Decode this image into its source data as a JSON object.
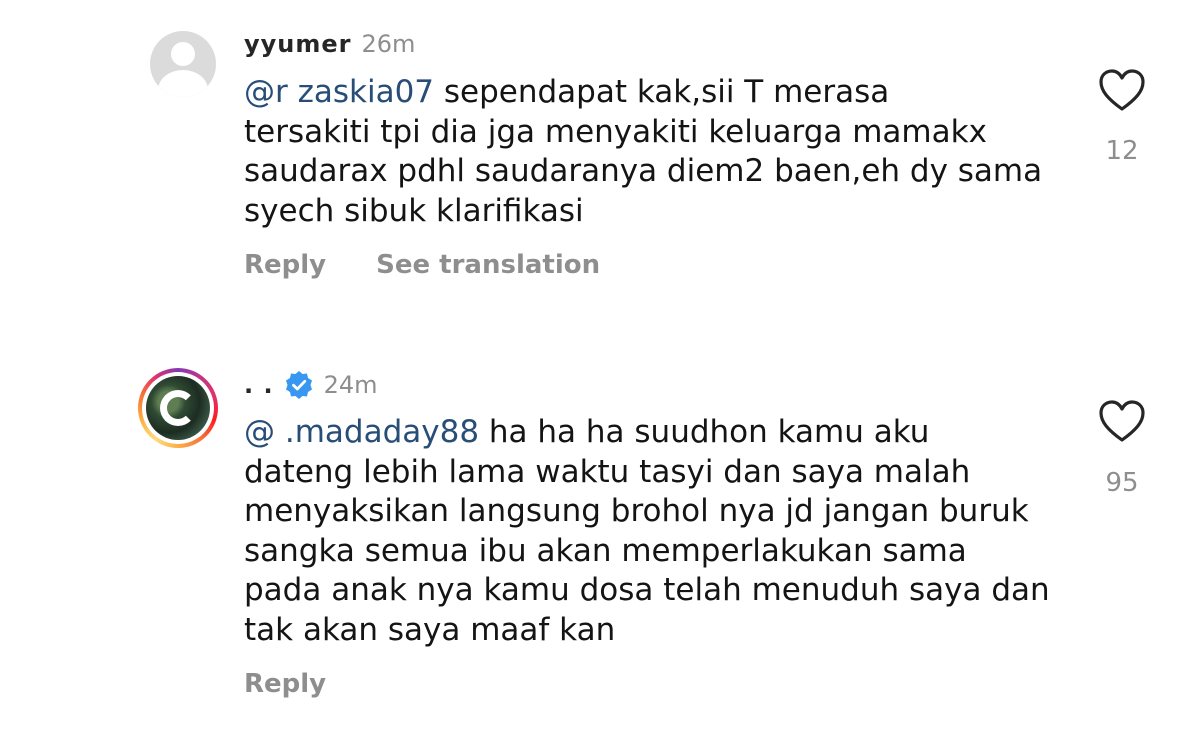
{
  "comments": [
    {
      "username": "yyumer",
      "time": "26m",
      "mention": "@r      zaskia07",
      "lines": [
        " sependapat kak,sii T merasa",
        "tersakiti tpi dia jga menyakiti keluarga mamakx",
        "saudarax pdhl saudaranya diem2 baen,eh dy sama",
        "syech sibuk klarifikasi"
      ],
      "reply_label": "Reply",
      "translate_label": "See translation",
      "like_count": "12"
    },
    {
      "username": ".        .",
      "time": "24m",
      "mention": "@   .madaday88",
      "lines": [
        " ha ha ha suudhon kamu aku",
        "dateng lebih lama waktu tasyi dan saya malah",
        "menyaksikan langsung brohol nya  jd jangan buruk",
        "sangka semua ibu akan memperlakukan sama",
        "pada anak nya kamu dosa telah menuduh saya dan",
        "tak akan saya maaf kan"
      ],
      "reply_label": "Reply",
      "like_count": "95"
    }
  ],
  "icons": {
    "like": "heart-outline-icon",
    "verified": "verified-badge-icon"
  },
  "colors": {
    "mention": "#284e77",
    "muted": "#8e8e8e",
    "verified": "#3897f0"
  }
}
